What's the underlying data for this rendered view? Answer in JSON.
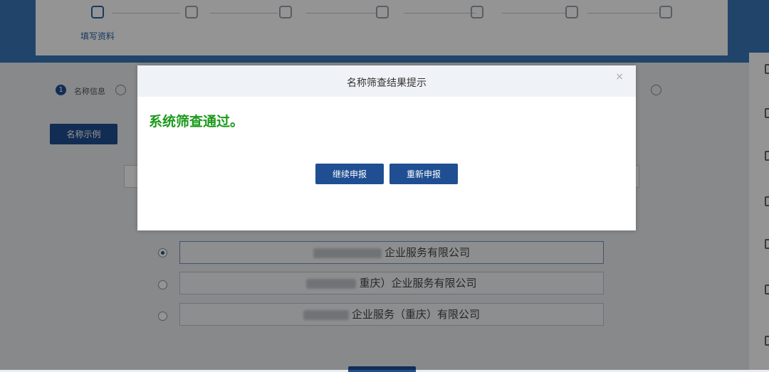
{
  "stepper": {
    "steps": [
      {
        "label": "填写资料",
        "active": true
      },
      {
        "label": "",
        "active": false
      },
      {
        "label": "",
        "active": false
      },
      {
        "label": "",
        "active": false
      },
      {
        "label": "",
        "active": false
      },
      {
        "label": "",
        "active": false
      },
      {
        "label": "",
        "active": false
      }
    ]
  },
  "sub_steps": {
    "first_num": "1",
    "first_label": "名称信息",
    "right_label": ""
  },
  "example_button": "名称示例",
  "options": [
    {
      "suffix": "企业服务有限公司",
      "selected": true
    },
    {
      "suffix": "重庆）企业服务有限公司",
      "selected": false
    },
    {
      "suffix": "企业服务（重庆）有限公司",
      "selected": false
    }
  ],
  "modal": {
    "title": "名称筛查结果提示",
    "close_glyph": "×",
    "message": "系统筛查通过。",
    "message_color": "#1c9a1c",
    "continue_label": "继续申报",
    "restart_label": "重新申报"
  },
  "colors": {
    "brand": "#1f4f92",
    "header_band": "#3a76b8"
  }
}
